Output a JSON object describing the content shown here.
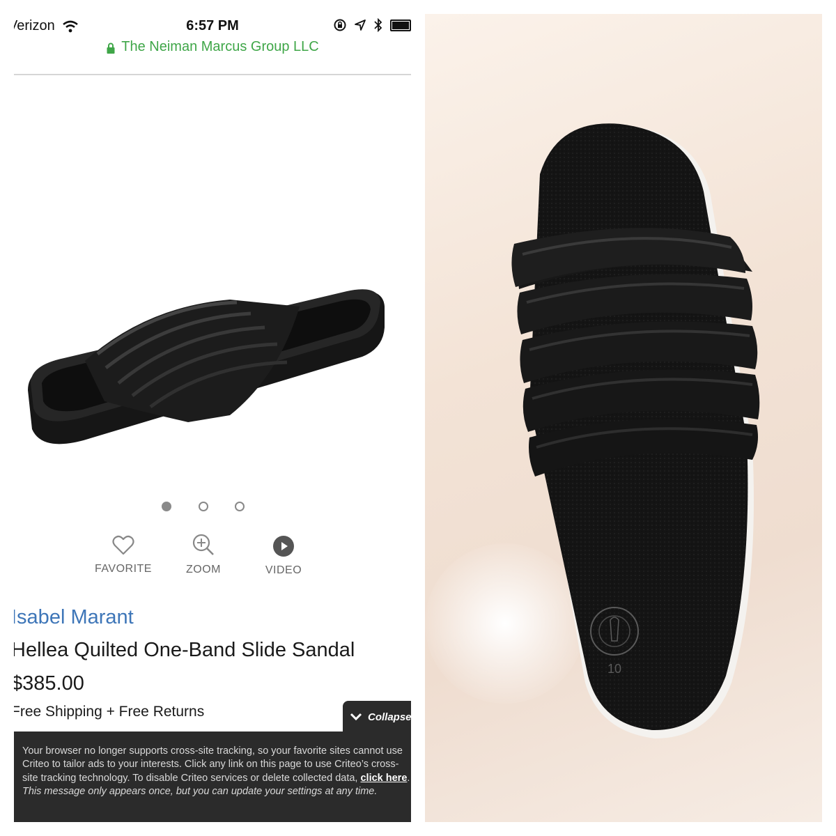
{
  "status_bar": {
    "carrier": "Verizon",
    "time": "6:57 PM"
  },
  "url_bar": {
    "site": "The Neiman Marcus Group LLC"
  },
  "carousel": {
    "count": 3,
    "active_index": 0
  },
  "actions": {
    "favorite": "FAVORITE",
    "zoom": "ZOOM",
    "video": "VIDEO"
  },
  "product": {
    "brand": "Isabel Marant",
    "name": "Hellea Quilted One-Band Slide Sandal",
    "price": "$385.00",
    "shipping": "Free Shipping + Free Returns"
  },
  "collapse": {
    "label": "Collapse"
  },
  "banner": {
    "text_1": "Your browser no longer supports cross-site tracking, so your favorite sites cannot use Criteo to tailor ads to your interests. Click any link on this page to use Criteo’s cross-site tracking technology. To disable Criteo services or delete collected data, ",
    "link": "click here",
    "text_2": ". ",
    "text_3": "This message only appears once, but you can update your settings at any time."
  },
  "photo": {
    "insole_size": "10"
  },
  "colors": {
    "brand_link": "#3e76b8",
    "secure_green": "#3fa648",
    "banner_bg": "#2b2b2b"
  }
}
